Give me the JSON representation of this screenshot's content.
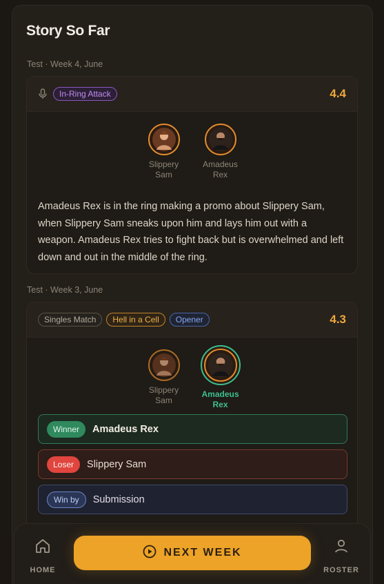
{
  "panel": {
    "title": "Story So Far"
  },
  "segments": [
    {
      "week_label": "Test · Week 4, June",
      "tags": [
        "In-Ring Attack"
      ],
      "score": "4.4",
      "participants": [
        {
          "name": "Slippery Sam"
        },
        {
          "name": "Amadeus Rex"
        }
      ],
      "story": "Amadeus Rex is in the ring making a promo about Slippery Sam, when Slippery Sam sneaks upon him and lays him out with a weapon. Amadeus Rex tries to fight back but is overwhelmed and left down and out in the middle of the ring."
    },
    {
      "week_label": "Test · Week 3, June",
      "tags": [
        "Singles Match",
        "Hell in a Cell",
        "Opener"
      ],
      "score": "4.3",
      "participants": [
        {
          "name": "Slippery Sam"
        },
        {
          "name": "Amadeus Rex"
        }
      ],
      "results": {
        "winner_label": "Winner",
        "winner": "Amadeus Rex",
        "loser_label": "Loser",
        "loser": "Slippery Sam",
        "winby_label": "Win by",
        "winby": "Submission"
      }
    }
  ],
  "nav": {
    "home": "HOME",
    "next_week": "NEXT WEEK",
    "roster": "ROSTER"
  },
  "colors": {
    "accent": "#eda327",
    "score": "#f0a93a",
    "winner": "#3dbf8f",
    "loser": "#e0453e",
    "winby": "#6d87c9"
  },
  "icons": [
    "microphone-icon",
    "home-icon",
    "play-circle-icon",
    "user-icon"
  ]
}
